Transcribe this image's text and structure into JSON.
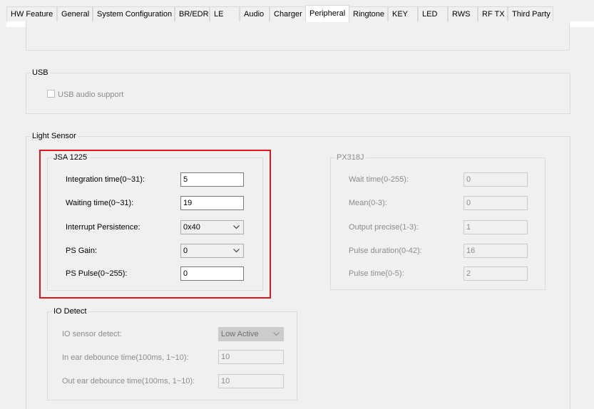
{
  "tabs": [
    {
      "label": "HW Feature"
    },
    {
      "label": "General"
    },
    {
      "label": "System Configuration"
    },
    {
      "label": "BR/EDR"
    },
    {
      "label": "LE"
    },
    {
      "label": "Audio"
    },
    {
      "label": "Charger"
    },
    {
      "label": "Peripheral",
      "active": true
    },
    {
      "label": "Ringtone"
    },
    {
      "label": "KEY"
    },
    {
      "label": "LED"
    },
    {
      "label": "RWS"
    },
    {
      "label": "RF TX"
    },
    {
      "label": "Third Party"
    }
  ],
  "usb": {
    "title": "USB",
    "audio_support_label": "USB audio support",
    "audio_support_checked": false
  },
  "light_sensor": {
    "title": "Light Sensor",
    "jsa1225": {
      "title": "JSA 1225",
      "integration_time_label": "Integration time(0~31):",
      "integration_time_value": "5",
      "waiting_time_label": "Waiting time(0~31):",
      "waiting_time_value": "19",
      "interrupt_persistence_label": "Interrupt Persistence:",
      "interrupt_persistence_value": "0x40",
      "ps_gain_label": "PS Gain:",
      "ps_gain_value": "0",
      "ps_pulse_label": "PS Pulse(0~255):",
      "ps_pulse_value": "0"
    },
    "px318j": {
      "title": "PX318J",
      "wait_time_label": "Wait time(0-255):",
      "wait_time_value": "0",
      "mean_label": "Mean(0-3):",
      "mean_value": "0",
      "output_precise_label": "Output precise(1-3):",
      "output_precise_value": "1",
      "pulse_duration_label": "Pulse duration(0-42):",
      "pulse_duration_value": "16",
      "pulse_time_label": "Pulse time(0-5):",
      "pulse_time_value": "2"
    },
    "io_detect": {
      "title": "IO Detect",
      "io_sensor_detect_label": "IO sensor detect:",
      "io_sensor_detect_value": "Low Active",
      "in_ear_debounce_label": "In ear debounce time(100ms, 1~10):",
      "in_ear_debounce_value": "10",
      "out_ear_debounce_label": "Out ear debounce time(100ms, 1~10):",
      "out_ear_debounce_value": "10"
    }
  },
  "colors": {
    "highlight_border": "#e2141a",
    "window_bg": "#f0f0f0",
    "disabled_text": "#8c8c8c"
  }
}
